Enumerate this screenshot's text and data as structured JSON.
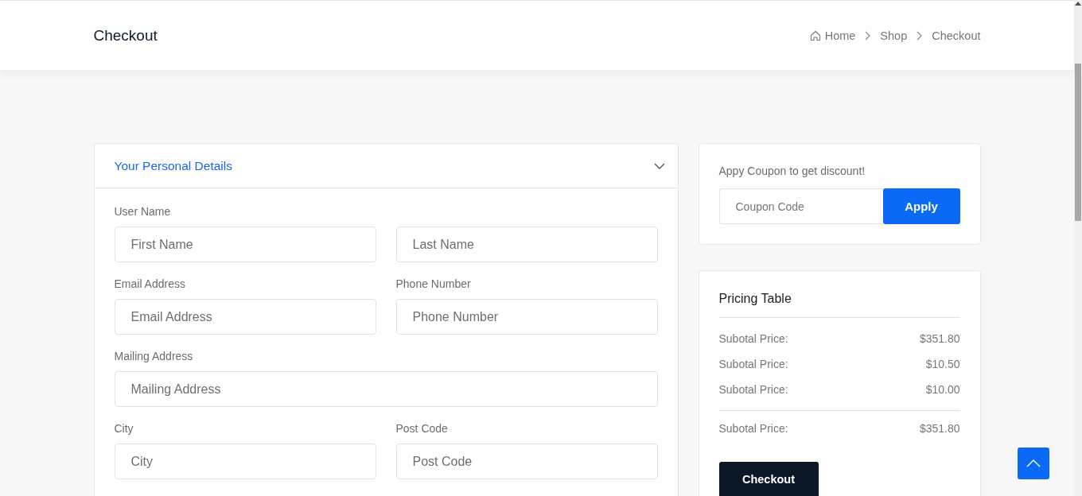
{
  "header": {
    "title": "Checkout",
    "breadcrumb": [
      {
        "label": "Home",
        "kind": "home"
      },
      {
        "label": "Shop",
        "kind": "link"
      },
      {
        "label": "Checkout",
        "kind": "current"
      }
    ]
  },
  "personal_details": {
    "title": "Your Personal Details",
    "expanded": true,
    "groups": [
      {
        "kind": "pair",
        "label": "User Name",
        "inputs": [
          {
            "placeholder": "First Name"
          },
          {
            "placeholder": "Last Name"
          }
        ]
      },
      {
        "kind": "half",
        "label": "Email Address",
        "inputs": [
          {
            "placeholder": "Email Address"
          }
        ]
      },
      {
        "kind": "half",
        "label": "Phone Number",
        "inputs": [
          {
            "placeholder": "Phone Number"
          }
        ]
      },
      {
        "kind": "full",
        "label": "Mailing Address",
        "inputs": [
          {
            "placeholder": "Mailing Address"
          }
        ]
      },
      {
        "kind": "half",
        "label": "City",
        "inputs": [
          {
            "placeholder": "City"
          }
        ]
      },
      {
        "kind": "half",
        "label": "Post Code",
        "inputs": [
          {
            "placeholder": "Post Code"
          }
        ]
      }
    ]
  },
  "coupon": {
    "prompt": "Appy Coupon to get discount!",
    "placeholder": "Coupon Code",
    "button": "Apply"
  },
  "pricing": {
    "title": "Pricing Table",
    "rows": [
      {
        "label": "Subotal Price:",
        "value": "$351.80"
      },
      {
        "label": "Subotal Price:",
        "value": "$10.50"
      },
      {
        "label": "Subotal Price:",
        "value": "$10.00"
      }
    ],
    "total": {
      "label": "Subotal Price:",
      "value": "$351.80"
    },
    "button": "Checkout"
  }
}
